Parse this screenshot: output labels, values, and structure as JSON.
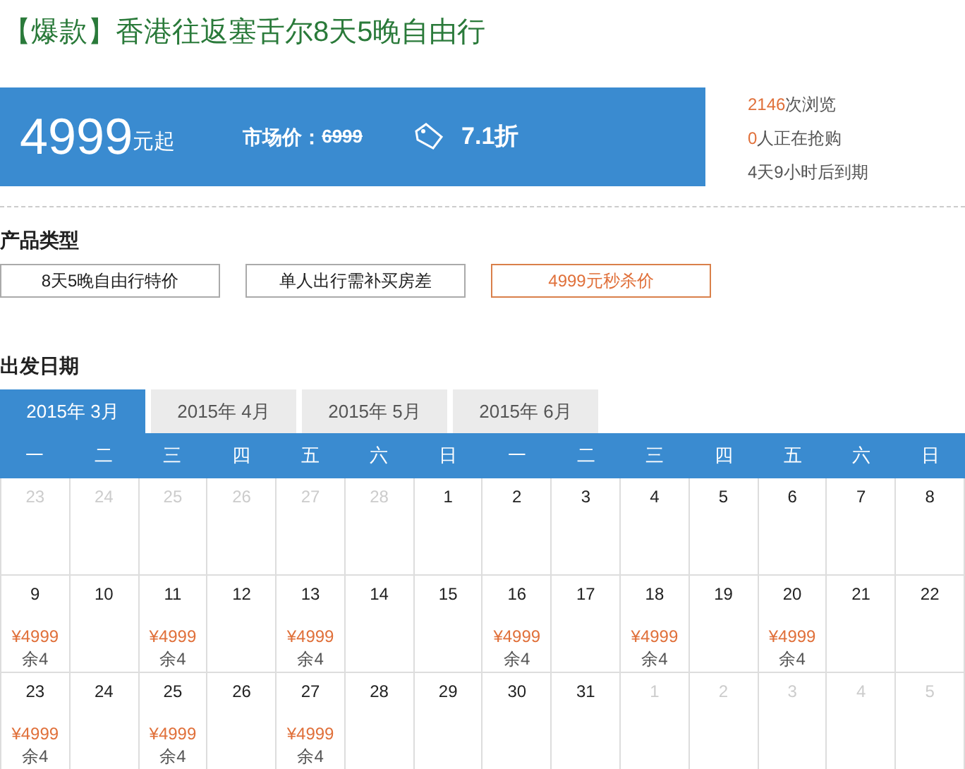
{
  "title": {
    "tag": "【爆款】",
    "text": "香港往返塞舌尔8天5晚自由行"
  },
  "price_banner": {
    "price": "4999",
    "price_unit": "元起",
    "market_label": "市场价：",
    "market_price": "6999",
    "discount": "7.1折"
  },
  "stats": [
    {
      "value": "2146",
      "label": "次浏览",
      "highlight": true
    },
    {
      "value": "0",
      "label": "人正在抢购",
      "highlight": true
    },
    {
      "value": "4天9小时后到期",
      "highlight": false
    }
  ],
  "product_types": {
    "heading": "产品类型",
    "options": [
      {
        "label": "8天5晚自由行特价",
        "selected": false
      },
      {
        "label": "单人出行需补买房差",
        "selected": false
      },
      {
        "label": "4999元秒杀价",
        "selected": true
      }
    ]
  },
  "departure": {
    "heading": "出发日期",
    "tabs": [
      {
        "label": "2015年 3月",
        "selected": true
      },
      {
        "label": "2015年 4月",
        "selected": false
      },
      {
        "label": "2015年 5月",
        "selected": false
      },
      {
        "label": "2015年 6月",
        "selected": false
      }
    ],
    "weekdays": [
      "一",
      "二",
      "三",
      "四",
      "五",
      "六",
      "日",
      "一",
      "二",
      "三",
      "四",
      "五",
      "六",
      "日"
    ],
    "weeks": [
      [
        {
          "day": "23",
          "muted": true
        },
        {
          "day": "24",
          "muted": true
        },
        {
          "day": "25",
          "muted": true
        },
        {
          "day": "26",
          "muted": true
        },
        {
          "day": "27",
          "muted": true
        },
        {
          "day": "28",
          "muted": true
        },
        {
          "day": "1",
          "muted": false
        },
        {
          "day": "2",
          "muted": false
        },
        {
          "day": "3",
          "muted": false
        },
        {
          "day": "4",
          "muted": false
        },
        {
          "day": "5",
          "muted": false
        },
        {
          "day": "6",
          "muted": false
        },
        {
          "day": "7",
          "muted": false
        },
        {
          "day": "8",
          "muted": false
        }
      ],
      [
        {
          "day": "9",
          "muted": false,
          "price": "¥4999",
          "stock": "余4"
        },
        {
          "day": "10",
          "muted": false
        },
        {
          "day": "11",
          "muted": false,
          "price": "¥4999",
          "stock": "余4"
        },
        {
          "day": "12",
          "muted": false
        },
        {
          "day": "13",
          "muted": false,
          "price": "¥4999",
          "stock": "余4"
        },
        {
          "day": "14",
          "muted": false
        },
        {
          "day": "15",
          "muted": false
        },
        {
          "day": "16",
          "muted": false,
          "price": "¥4999",
          "stock": "余4"
        },
        {
          "day": "17",
          "muted": false
        },
        {
          "day": "18",
          "muted": false,
          "price": "¥4999",
          "stock": "余4"
        },
        {
          "day": "19",
          "muted": false
        },
        {
          "day": "20",
          "muted": false,
          "price": "¥4999",
          "stock": "余4"
        },
        {
          "day": "21",
          "muted": false
        },
        {
          "day": "22",
          "muted": false
        }
      ],
      [
        {
          "day": "23",
          "muted": false,
          "price": "¥4999",
          "stock": "余4"
        },
        {
          "day": "24",
          "muted": false
        },
        {
          "day": "25",
          "muted": false,
          "price": "¥4999",
          "stock": "余4"
        },
        {
          "day": "26",
          "muted": false
        },
        {
          "day": "27",
          "muted": false,
          "price": "¥4999",
          "stock": "余4"
        },
        {
          "day": "28",
          "muted": false
        },
        {
          "day": "29",
          "muted": false
        },
        {
          "day": "30",
          "muted": false
        },
        {
          "day": "31",
          "muted": false
        },
        {
          "day": "1",
          "muted": true
        },
        {
          "day": "2",
          "muted": true
        },
        {
          "day": "3",
          "muted": true
        },
        {
          "day": "4",
          "muted": true
        },
        {
          "day": "5",
          "muted": true
        }
      ]
    ]
  }
}
